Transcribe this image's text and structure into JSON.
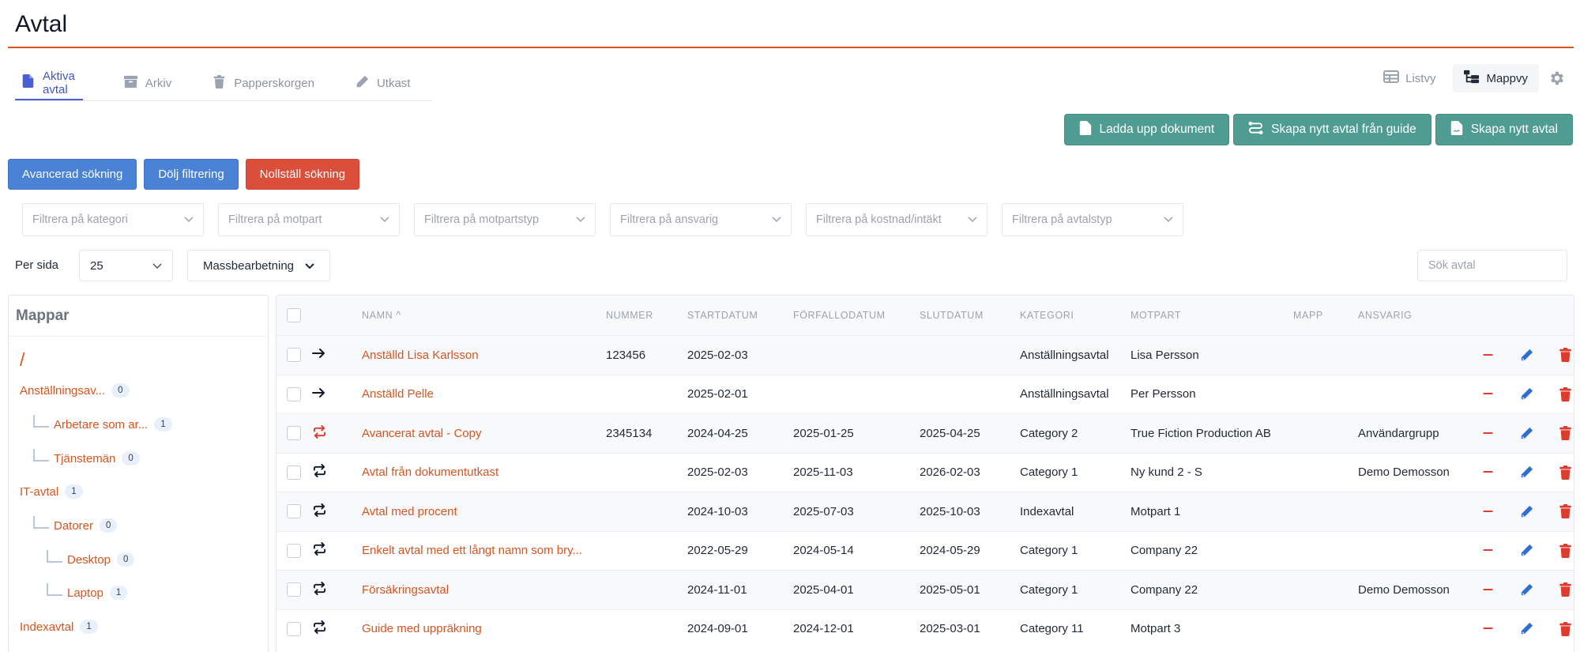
{
  "page": {
    "title": "Avtal"
  },
  "tabs": [
    {
      "label": "Aktiva avtal",
      "icon": "file-icon",
      "active": true
    },
    {
      "label": "Arkiv",
      "icon": "archive-icon",
      "active": false
    },
    {
      "label": "Papperskorgen",
      "icon": "trash-icon",
      "active": false
    },
    {
      "label": "Utkast",
      "icon": "pencil-icon",
      "active": false
    }
  ],
  "views": {
    "list_label": "Listvy",
    "folder_label": "Mappvy",
    "active": "Mappvy"
  },
  "actions": {
    "upload_label": "Ladda upp dokument",
    "guide_label": "Skapa nytt avtal från guide",
    "new_label": "Skapa nytt avtal"
  },
  "search_buttons": {
    "advanced_label": "Avancerad sökning",
    "hide_label": "Dölj filtrering",
    "reset_label": "Nollställ sökning"
  },
  "filters": [
    "Filtrera på kategori",
    "Filtrera på motpart",
    "Filtrera på motpartstyp",
    "Filtrera på ansvarig",
    "Filtrera på kostnad/intäkt",
    "Filtrera på avtalstyp"
  ],
  "pagination": {
    "per_page_label": "Per sida",
    "per_page_value": "25"
  },
  "bulk": {
    "label": "Massbearbetning"
  },
  "search": {
    "placeholder": "Sök avtal"
  },
  "folders": {
    "title": "Mappar",
    "root": "/",
    "items": [
      {
        "label": "Anställningsav...",
        "count": "0",
        "depth": 0
      },
      {
        "label": "Arbetare som ar...",
        "count": "1",
        "depth": 1
      },
      {
        "label": "Tjänstemän",
        "count": "0",
        "depth": 1
      },
      {
        "label": "IT-avtal",
        "count": "1",
        "depth": 0
      },
      {
        "label": "Datorer",
        "count": "0",
        "depth": 1
      },
      {
        "label": "Desktop",
        "count": "0",
        "depth": 2
      },
      {
        "label": "Laptop",
        "count": "1",
        "depth": 2
      },
      {
        "label": "Indexavtal",
        "count": "1",
        "depth": 0
      }
    ]
  },
  "table": {
    "headers": {
      "namn": "NAMN ^",
      "nummer": "NUMMER",
      "startdatum": "STARTDATUM",
      "forfallodatum": "FÖRFALLODATUM",
      "slutdatum": "SLUTDATUM",
      "kategori": "KATEGORI",
      "motpart": "MOTPART",
      "mapp": "MAPP",
      "ansvarig": "ANSVARIG"
    },
    "rows": [
      {
        "type": "arrow",
        "typeColor": "#111827",
        "namn": "Anställd Lisa Karlsson",
        "nummer": "123456",
        "startdatum": "2025-02-03",
        "forfallodatum": "",
        "slutdatum": "",
        "kategori": "Anställningsavtal",
        "motpart": "Lisa Persson",
        "mapp": "",
        "ansvarig": ""
      },
      {
        "type": "arrow",
        "typeColor": "#111827",
        "namn": "Anställd Pelle",
        "nummer": "",
        "startdatum": "2025-02-01",
        "forfallodatum": "",
        "slutdatum": "",
        "kategori": "Anställningsavtal",
        "motpart": "Per Persson",
        "mapp": "",
        "ansvarig": ""
      },
      {
        "type": "repeat",
        "typeColor": "#dc3b2e",
        "namn": "Avancerat avtal - Copy",
        "nummer": "2345134",
        "startdatum": "2024-04-25",
        "forfallodatum": "2025-01-25",
        "slutdatum": "2025-04-25",
        "kategori": "Category 2",
        "motpart": "True Fiction Production AB",
        "mapp": "",
        "ansvarig": "Användargrupp"
      },
      {
        "type": "repeat",
        "typeColor": "#111827",
        "namn": "Avtal från dokumentutkast",
        "nummer": "",
        "startdatum": "2025-02-03",
        "forfallodatum": "2025-11-03",
        "slutdatum": "2026-02-03",
        "kategori": "Category 1",
        "motpart": "Ny kund 2 - S",
        "mapp": "",
        "ansvarig": "Demo Demosson"
      },
      {
        "type": "repeat",
        "typeColor": "#111827",
        "namn": "Avtal med procent",
        "nummer": "",
        "startdatum": "2024-10-03",
        "forfallodatum": "2025-07-03",
        "slutdatum": "2025-10-03",
        "kategori": "Indexavtal",
        "motpart": "Motpart 1",
        "mapp": "",
        "ansvarig": ""
      },
      {
        "type": "repeat",
        "typeColor": "#111827",
        "namn": "Enkelt avtal med ett långt namn som bry...",
        "nummer": "",
        "startdatum": "2022-05-29",
        "forfallodatum": "2024-05-14",
        "slutdatum": "2024-05-29",
        "kategori": "Category 1",
        "motpart": "Company 22",
        "mapp": "",
        "ansvarig": ""
      },
      {
        "type": "repeat",
        "typeColor": "#111827",
        "namn": "Försäkringsavtal",
        "nummer": "",
        "startdatum": "2024-11-01",
        "forfallodatum": "2025-04-01",
        "slutdatum": "2025-05-01",
        "kategori": "Category 1",
        "motpart": "Company 22",
        "mapp": "",
        "ansvarig": "Demo Demosson"
      },
      {
        "type": "repeat",
        "typeColor": "#111827",
        "namn": "Guide med uppräkning",
        "nummer": "",
        "startdatum": "2024-09-01",
        "forfallodatum": "2024-12-01",
        "slutdatum": "2025-03-01",
        "kategori": "Category 11",
        "motpart": "Motpart 3",
        "mapp": "",
        "ansvarig": ""
      }
    ]
  },
  "colors": {
    "accent": "#d9541f",
    "teal": "#4f9c92",
    "blue": "#4a82d6",
    "red": "#db4e3a",
    "tab_active": "#4355c7",
    "edit": "#2f6fd0",
    "delete": "#dc3b2e"
  }
}
